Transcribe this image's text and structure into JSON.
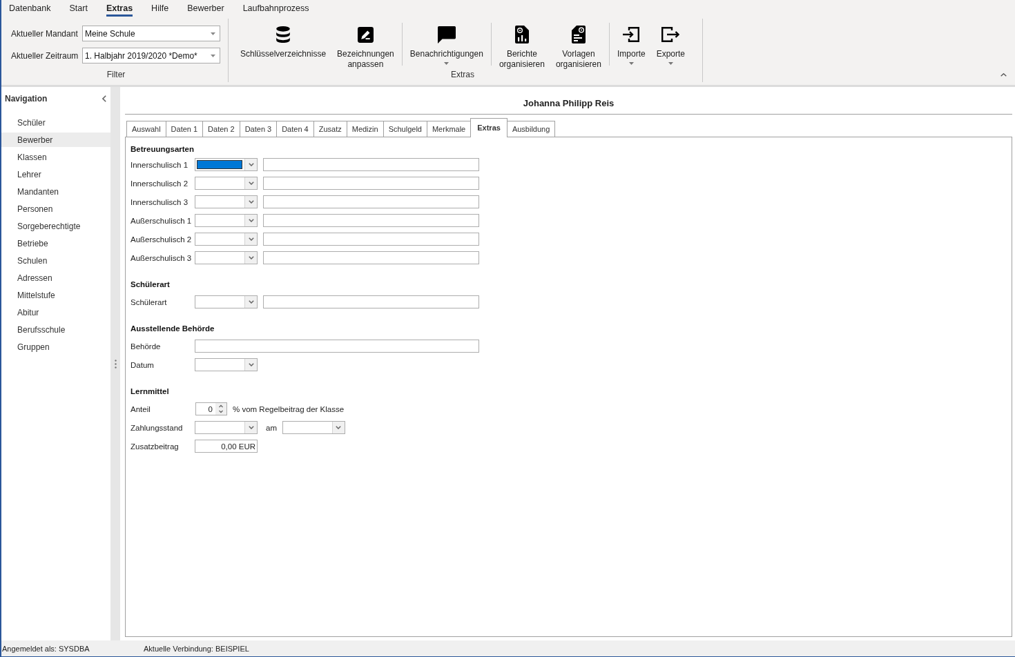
{
  "menu_tabs": [
    {
      "label": "Datenbank",
      "selected": false
    },
    {
      "label": "Start",
      "selected": false
    },
    {
      "label": "Extras",
      "selected": true
    },
    {
      "label": "Hilfe",
      "selected": false
    },
    {
      "label": "Bewerber",
      "selected": false
    },
    {
      "label": "Laufbahnprozess",
      "selected": false
    }
  ],
  "ribbon": {
    "filter_group": {
      "fields": [
        {
          "label": "Aktueller Mandant",
          "value": "Meine Schule"
        },
        {
          "label": "Aktueller Zeitraum",
          "value": "1. Halbjahr 2019/2020 *Demo*"
        }
      ],
      "label": "Filter"
    },
    "extras_group": {
      "clusters": [
        {
          "buttons": [
            {
              "label": "Schlüsselverzeichnisse",
              "dropdown": false
            },
            {
              "label": "Bezeichnungen anpassen",
              "dropdown": false
            }
          ]
        },
        {
          "buttons": [
            {
              "label": "Benachrichtigungen",
              "dropdown": true
            }
          ]
        },
        {
          "buttons": [
            {
              "label": "Berichte organisieren",
              "dropdown": false
            },
            {
              "label": "Vorlagen organisieren",
              "dropdown": false
            }
          ]
        },
        {
          "buttons": [
            {
              "label": "Importe",
              "dropdown": true
            },
            {
              "label": "Exporte",
              "dropdown": true
            }
          ]
        }
      ],
      "label": "Extras"
    }
  },
  "navigation": {
    "title": "Navigation",
    "items": [
      {
        "label": "Schüler",
        "selected": false
      },
      {
        "label": "Bewerber",
        "selected": true
      },
      {
        "label": "Klassen",
        "selected": false
      },
      {
        "label": "Lehrer",
        "selected": false
      },
      {
        "label": "Mandanten",
        "selected": false
      },
      {
        "label": "Personen",
        "selected": false
      },
      {
        "label": "Sorgeberechtigte",
        "selected": false
      },
      {
        "label": "Betriebe",
        "selected": false
      },
      {
        "label": "Schulen",
        "selected": false
      },
      {
        "label": "Adressen",
        "selected": false
      },
      {
        "label": "Mittelstufe",
        "selected": false
      },
      {
        "label": "Abitur",
        "selected": false
      },
      {
        "label": "Berufsschule",
        "selected": false
      },
      {
        "label": "Gruppen",
        "selected": false
      }
    ]
  },
  "record": {
    "title": "Johanna Philipp Reis",
    "tabs": [
      {
        "label": "Auswahl",
        "selected": false
      },
      {
        "label": "Daten 1",
        "selected": false
      },
      {
        "label": "Daten 2",
        "selected": false
      },
      {
        "label": "Daten 3",
        "selected": false
      },
      {
        "label": "Daten 4",
        "selected": false
      },
      {
        "label": "Zusatz",
        "selected": false
      },
      {
        "label": "Medizin",
        "selected": false
      },
      {
        "label": "Schulgeld",
        "selected": false
      },
      {
        "label": "Merkmale",
        "selected": false
      },
      {
        "label": "Extras",
        "selected": true
      },
      {
        "label": "Ausbildung",
        "selected": false
      }
    ],
    "sections": [
      {
        "heading": "Betreuungsarten",
        "rows": [
          {
            "kind": "combo_text",
            "label": "Innerschulisch 1",
            "focused": true
          },
          {
            "kind": "combo_text",
            "label": "Innerschulisch 2",
            "focused": false
          },
          {
            "kind": "combo_text",
            "label": "Innerschulisch 3",
            "focused": false
          },
          {
            "kind": "combo_text",
            "label": "Außerschulisch 1",
            "focused": false
          },
          {
            "kind": "combo_text",
            "label": "Außerschulisch 2",
            "focused": false
          },
          {
            "kind": "combo_text",
            "label": "Außerschulisch 3",
            "focused": false
          }
        ]
      },
      {
        "heading": "Schülerart",
        "rows": [
          {
            "kind": "combo_text",
            "label": "Schülerart",
            "focused": false
          }
        ]
      },
      {
        "heading": "Ausstellende Behörde",
        "rows": [
          {
            "kind": "text",
            "label": "Behörde",
            "focused": false
          },
          {
            "kind": "combo",
            "label": "Datum",
            "focused": false
          }
        ]
      },
      {
        "heading": "Lernmittel",
        "rows": [
          {
            "kind": "spin",
            "label": "Anteil",
            "value": "0",
            "suffix": "% vom Regelbeitrag der Klasse",
            "focused": false
          },
          {
            "kind": "combo_combo",
            "label": "Zahlungsstand",
            "between": "am",
            "focused": false
          },
          {
            "kind": "amount",
            "label": "Zusatzbeitrag",
            "value": "0,00 EUR",
            "focused": false
          }
        ]
      }
    ]
  },
  "status_bar": {
    "items": [
      "Angemeldet als: SYSDBA",
      "Aktuelle Verbindung: BEISPIEL"
    ]
  }
}
